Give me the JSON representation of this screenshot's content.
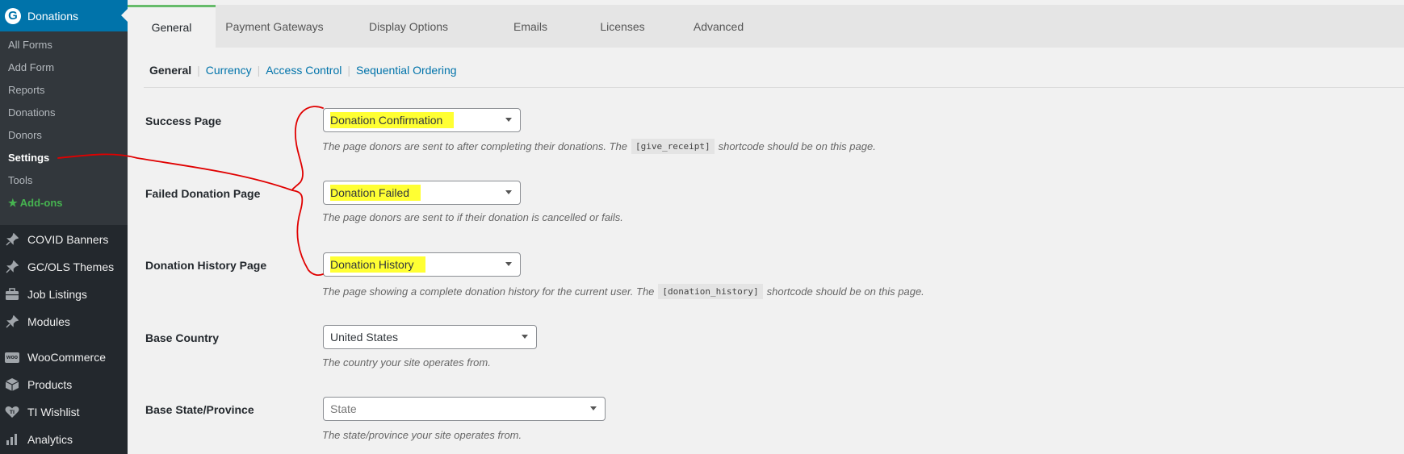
{
  "sidebar": {
    "top": {
      "label": "Donations",
      "icon": "give-logo-icon",
      "icon_glyph": "G"
    },
    "submenu": [
      {
        "label": "All Forms"
      },
      {
        "label": "Add Form"
      },
      {
        "label": "Reports"
      },
      {
        "label": "Donations"
      },
      {
        "label": "Donors"
      },
      {
        "label": "Settings"
      },
      {
        "label": "Tools"
      },
      {
        "label": "Add-ons"
      }
    ],
    "items": [
      {
        "label": "COVID Banners",
        "icon": "pin-icon"
      },
      {
        "label": "GC/OLS Themes",
        "icon": "pin-icon"
      },
      {
        "label": "Job Listings",
        "icon": "briefcase-icon"
      },
      {
        "label": "Modules",
        "icon": "pin-icon"
      },
      {
        "label": "WooCommerce",
        "icon": "woocommerce-icon",
        "icon_text": "woo"
      },
      {
        "label": "Products",
        "icon": "box-icon"
      },
      {
        "label": "TI Wishlist",
        "icon": "heart-icon"
      },
      {
        "label": "Analytics",
        "icon": "bar-chart-icon"
      }
    ]
  },
  "tabs": [
    {
      "label": "General"
    },
    {
      "label": "Payment Gateways"
    },
    {
      "label": "Display Options"
    },
    {
      "label": "Emails"
    },
    {
      "label": "Licenses"
    },
    {
      "label": "Advanced"
    }
  ],
  "subtabs": [
    {
      "label": "General"
    },
    {
      "label": "Currency"
    },
    {
      "label": "Access Control"
    },
    {
      "label": "Sequential Ordering"
    }
  ],
  "fields": [
    {
      "label": "Success Page",
      "value": "Donation Confirmation",
      "desc_before": "The page donors are sent to after completing their donations. The",
      "code": "[give_receipt]",
      "desc_after": "shortcode should be on this page."
    },
    {
      "label": "Failed Donation Page",
      "value": "Donation Failed",
      "desc_before": "The page donors are sent to if their donation is cancelled or fails."
    },
    {
      "label": "Donation History Page",
      "value": "Donation History",
      "desc_before": "The page showing a complete donation history for the current user. The",
      "code": "[donation_history]",
      "desc_after": "shortcode should be on this page."
    },
    {
      "label": "Base Country",
      "value": "United States",
      "desc_before": "The country your site operates from."
    },
    {
      "label": "Base State/Province",
      "placeholder": "State",
      "desc_before": "The state/province your site operates from."
    }
  ],
  "colors": {
    "sidebar_bg": "#23282d",
    "submenu_bg": "#32373c",
    "accent_blue": "#0073aa",
    "active_tab_border": "#66bb6a",
    "highlight": "#ffff33",
    "annotation_red": "#e00000"
  }
}
